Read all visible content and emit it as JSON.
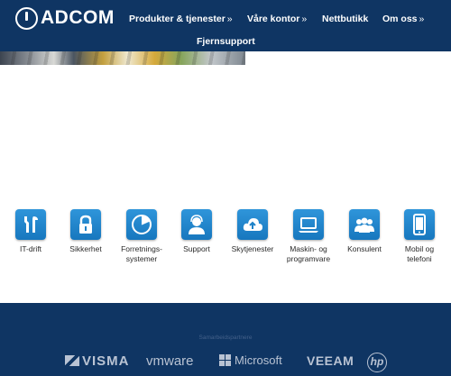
{
  "brand": {
    "name": "ADCOM"
  },
  "nav": {
    "items": [
      {
        "label": "Produkter & tjenester",
        "arrow": "»"
      },
      {
        "label": "Våre kontor",
        "arrow": "»"
      },
      {
        "label": "Nettbutikk",
        "arrow": ""
      },
      {
        "label": "Om oss",
        "arrow": "»"
      },
      {
        "label": "Fjernsupport",
        "arrow": ""
      }
    ]
  },
  "services": [
    {
      "label": "IT-drift",
      "icon": "tools-icon"
    },
    {
      "label": "Sikkerhet",
      "icon": "padlock-icon"
    },
    {
      "label": "Forretnings-\nsystemer",
      "icon": "pie-chart-icon"
    },
    {
      "label": "Support",
      "icon": "support-agent-icon"
    },
    {
      "label": "Skytjenester",
      "icon": "cloud-upload-icon"
    },
    {
      "label": "Maskin- og\nprogramvare",
      "icon": "laptop-icon"
    },
    {
      "label": "Konsulent",
      "icon": "group-icon"
    },
    {
      "label": "Mobil og\ntelefoni",
      "icon": "smartphone-icon"
    }
  ],
  "partners": {
    "label": "Samarbeidspartnere",
    "logos": [
      "VISMA",
      "vmware",
      "Microsoft",
      "VEEAM",
      "hp"
    ]
  },
  "colors": {
    "header": "#0f3563",
    "tile": "#1e82c8",
    "footer": "#0f3563"
  }
}
